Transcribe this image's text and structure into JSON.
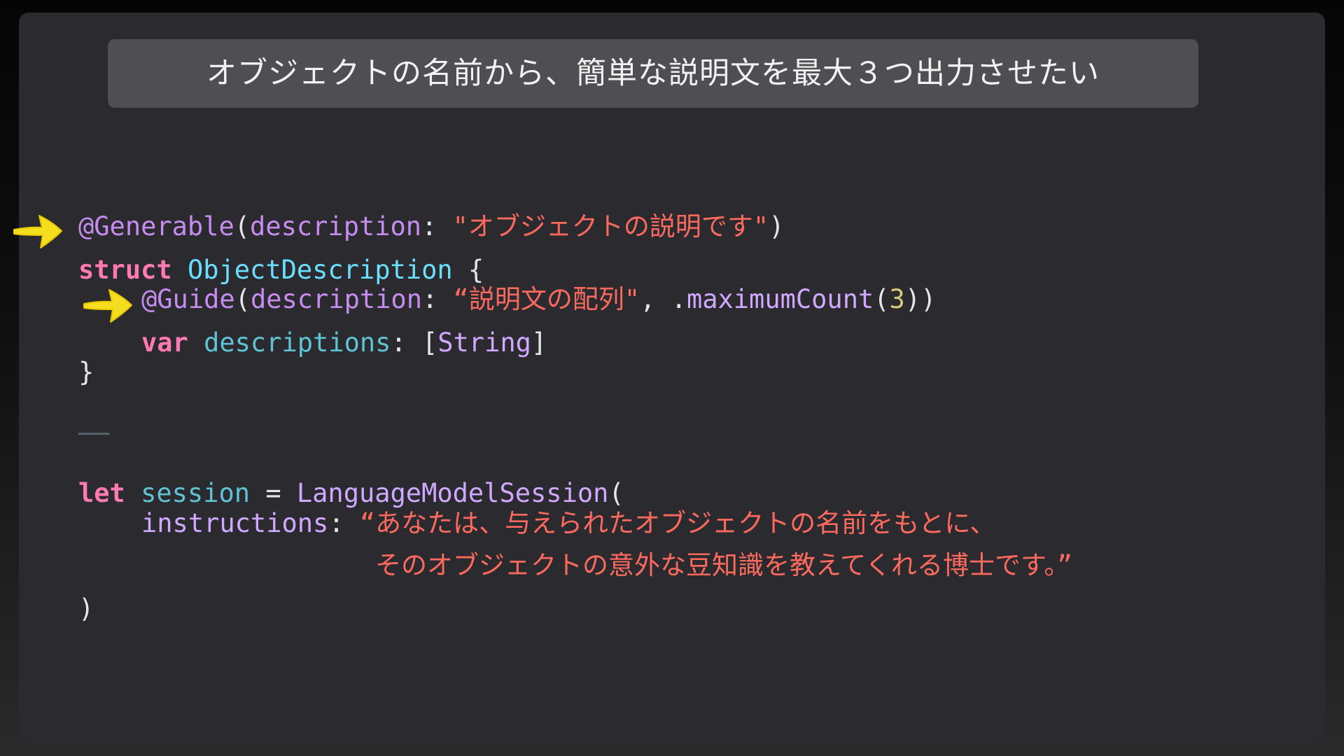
{
  "banner": {
    "title": "オブジェクトの名前から、簡単な説明文を最大３つ出力させたい"
  },
  "code": {
    "line1": {
      "attr": "@Generable",
      "open": "(",
      "label": "description",
      "colon": ": ",
      "str": "\"オブジェクトの説明です\"",
      "close": ")"
    },
    "line2": {
      "kw": "struct",
      "type": "ObjectDescription",
      "brace": " {"
    },
    "line3": {
      "attr": "@Guide",
      "open": "(",
      "label": "description",
      "colon": ": ",
      "str": "“説明文の配列\"",
      "comma": ", .",
      "method": "maximumCount",
      "paren": "(",
      "num": "3",
      "close": "))"
    },
    "line4": {
      "kw": "var",
      "ident": "descriptions",
      "colon": ": [",
      "type": "String",
      "close": "]"
    },
    "line5": {
      "brace": "}"
    },
    "separator": "——",
    "line6": {
      "kw": "let",
      "ident": "session",
      "eq": " = ",
      "type": "LanguageModelSession",
      "open": "("
    },
    "line7": {
      "label": "instructions",
      "colon": ": ",
      "str": "“あなたは、与えられたオブジェクトの名前をもとに、"
    },
    "line8": {
      "str": "そのオブジェクトの意外な豆知識を教えてくれる博士です。”"
    },
    "line9": {
      "close": ")"
    }
  },
  "icons": {
    "arrow1": "pointing-arrow-icon",
    "arrow2": "pointing-arrow-icon"
  },
  "colors": {
    "panel": "#2a2a2f",
    "banner": "#4e4e53",
    "keyword": "#ff7ab2",
    "attribute": "#c68cf0",
    "type": "#6bdfff",
    "string": "#fc6a5d",
    "number": "#d9c97c",
    "arrow": "#f5dd1f"
  }
}
